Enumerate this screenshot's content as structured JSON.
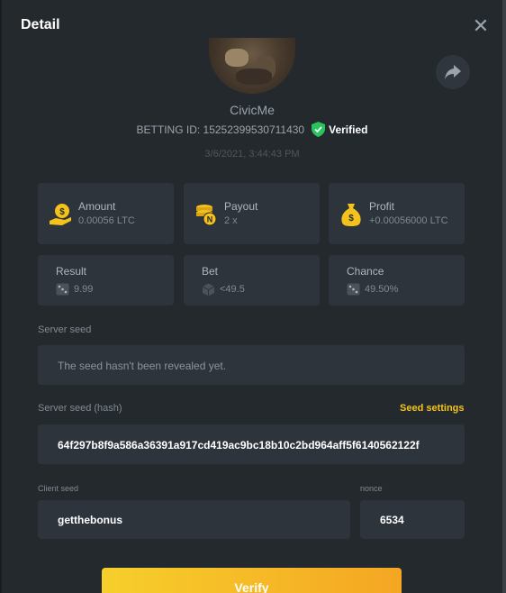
{
  "header": {
    "title": "Detail"
  },
  "user": {
    "name": "CivicMe"
  },
  "bet": {
    "id_label": "BETTING ID: 15252399530711430",
    "verified_label": "Verified",
    "datetime": "3/6/2021, 3:44:43 PM"
  },
  "stats": {
    "amount": {
      "label": "Amount",
      "value": "0.00056 LTC"
    },
    "payout": {
      "label": "Payout",
      "value": "2 x"
    },
    "profit": {
      "label": "Profit",
      "value": "+0.00056000 LTC"
    },
    "result": {
      "label": "Result",
      "value": "9.99"
    },
    "bet": {
      "label": "Bet",
      "value": "<49.5"
    },
    "chance": {
      "label": "Chance",
      "value": "49.50%"
    }
  },
  "server_seed": {
    "label": "Server seed",
    "value": "The seed hasn't been revealed yet."
  },
  "server_seed_hash": {
    "label": "Server seed (hash)",
    "settings_link": "Seed settings",
    "value": "64f297b8f9a586a36391a917cd419ac9bc18b10c2bd964aff5f6140562122f"
  },
  "client_seed": {
    "label": "Client seed",
    "value": "getthebonus"
  },
  "nonce": {
    "label": "nonce",
    "value": "6534"
  },
  "actions": {
    "verify_label": "Verify"
  },
  "colors": {
    "accent": "#f4c31b",
    "verified": "#29c45d",
    "background": "#24292e",
    "card": "#2d343b"
  }
}
